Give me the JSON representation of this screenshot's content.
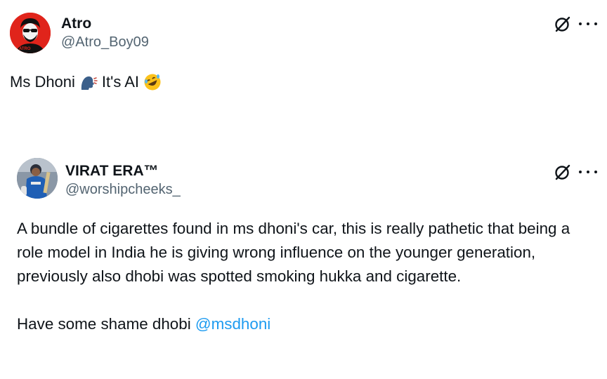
{
  "outer_tweet": {
    "display_name": "Atro",
    "handle": "@Atro_Boy09",
    "text_part1": "Ms Dhoni",
    "emoji1": "speaking-head-emoji",
    "text_part2": "It's AI",
    "emoji2": "rolling-on-floor-laughing-emoji",
    "avatar_label": "ATRO"
  },
  "quoted_tweet": {
    "display_name": "VIRAT ERA™",
    "handle": "@worshipcheeks_",
    "paragraph1": "A bundle of cigarettes found in ms dhoni's car, this is really pathetic that being a role model in India he is giving wrong influence on the younger generation, previously also dhobi was spotted smoking hukka and cigarette.",
    "paragraph2_text": "Have some shame dhobi ",
    "mention": "@msdhoni"
  },
  "icons": {
    "grok": "grok-icon",
    "more": "more-options-icon"
  },
  "colors": {
    "text": "#0f1419",
    "secondary": "#536471",
    "link": "#1d9bf0",
    "avatar_red": "#e0241b"
  }
}
